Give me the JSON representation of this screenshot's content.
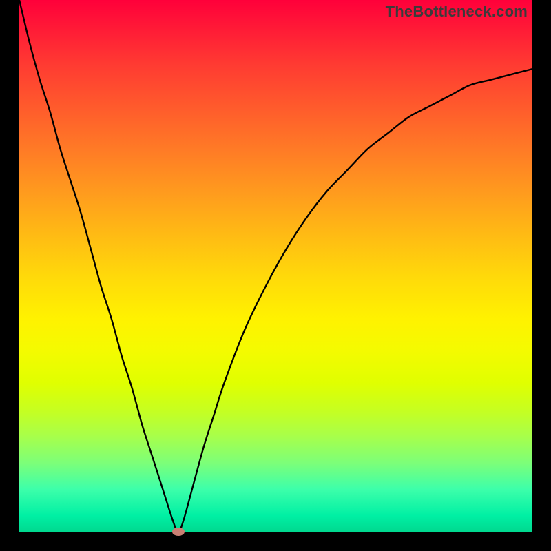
{
  "watermark": "TheBottleneck.com",
  "colors": {
    "frame": "#000000",
    "curve": "#000000",
    "marker": "#c97f73",
    "gradient_top": "#ff003a",
    "gradient_bottom": "#00d98f"
  },
  "chart_data": {
    "type": "line",
    "title": "",
    "xlabel": "",
    "ylabel": "",
    "xlim": [
      0,
      100
    ],
    "ylim": [
      0,
      100
    ],
    "grid": false,
    "x": [
      0,
      2,
      4,
      6,
      8,
      10,
      12,
      14,
      16,
      18,
      20,
      22,
      24,
      26,
      28,
      30,
      31,
      32,
      34,
      36,
      38,
      40,
      44,
      48,
      52,
      56,
      60,
      64,
      68,
      72,
      76,
      80,
      84,
      88,
      92,
      96,
      100
    ],
    "values": [
      100,
      92,
      85,
      79,
      72,
      66,
      60,
      53,
      46,
      40,
      33,
      27,
      20,
      14,
      8,
      2,
      0,
      2,
      9,
      16,
      22,
      28,
      38,
      46,
      53,
      59,
      64,
      68,
      72,
      75,
      78,
      80,
      82,
      84,
      85,
      86,
      87
    ],
    "marker": {
      "x": 31,
      "y": 0
    },
    "annotations": []
  }
}
